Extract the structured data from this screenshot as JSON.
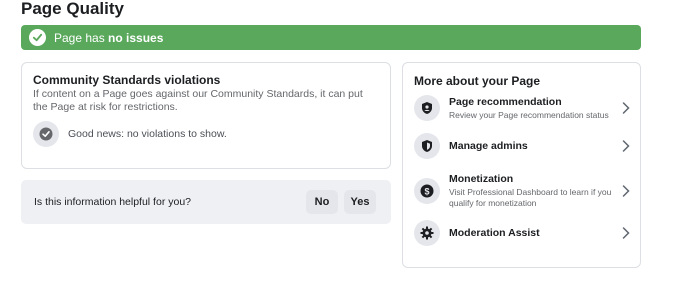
{
  "page_title": "Page Quality",
  "banner": {
    "text_prefix": "Page has ",
    "text_bold": "no issues",
    "color": "#5aa85c"
  },
  "standards": {
    "title": "Community Standards violations",
    "description": "If content on a Page goes against our Community Standards, it can put the Page at risk for restrictions.",
    "status_text": "Good news: no violations to show."
  },
  "helpful": {
    "question": "Is this information helpful for you?",
    "no_label": "No",
    "yes_label": "Yes"
  },
  "more": {
    "title": "More about your Page",
    "items": [
      {
        "icon": "badge-icon",
        "title": "Page recommendation",
        "subtitle": "Review your Page recommendation status"
      },
      {
        "icon": "shield-icon",
        "title": "Manage admins",
        "subtitle": ""
      },
      {
        "icon": "dollar-icon",
        "title": "Monetization",
        "subtitle": "Visit Professional Dashboard to learn if you qualify for monetization"
      },
      {
        "icon": "gear-icon",
        "title": "Moderation Assist",
        "subtitle": ""
      }
    ]
  }
}
